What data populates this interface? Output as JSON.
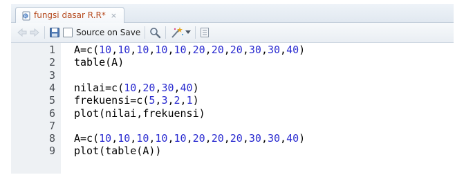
{
  "tab": {
    "title": "fungsi dasar R.R*",
    "close": "×"
  },
  "toolbar": {
    "source_on_save_label": "Source on Save",
    "source_on_save_checked": false
  },
  "editor": {
    "lines": [
      {
        "n": "1",
        "text": "A=c(10,10,10,10,10,20,20,20,30,30,40)"
      },
      {
        "n": "2",
        "text": "table(A)"
      },
      {
        "n": "3",
        "text": ""
      },
      {
        "n": "4",
        "text": "nilai=c(10,20,30,40)"
      },
      {
        "n": "5",
        "text": "frekuensi=c(5,3,2,1)"
      },
      {
        "n": "6",
        "text": "plot(nilai,frekuensi)"
      },
      {
        "n": "7",
        "text": ""
      },
      {
        "n": "8",
        "text": "A=c(10,10,10,10,10,20,20,20,30,30,40)"
      },
      {
        "n": "9",
        "text": "plot(table(A))"
      }
    ]
  },
  "colors": {
    "tab_title": "#b5481c",
    "number_literal": "#2a2bd0",
    "gutter_bg": "#eef1f4"
  },
  "icons": [
    "r-file-icon",
    "back-arrow-icon",
    "forward-arrow-icon",
    "save-icon",
    "search-icon",
    "magic-wand-icon",
    "dropdown-arrow-icon",
    "compile-report-icon"
  ]
}
